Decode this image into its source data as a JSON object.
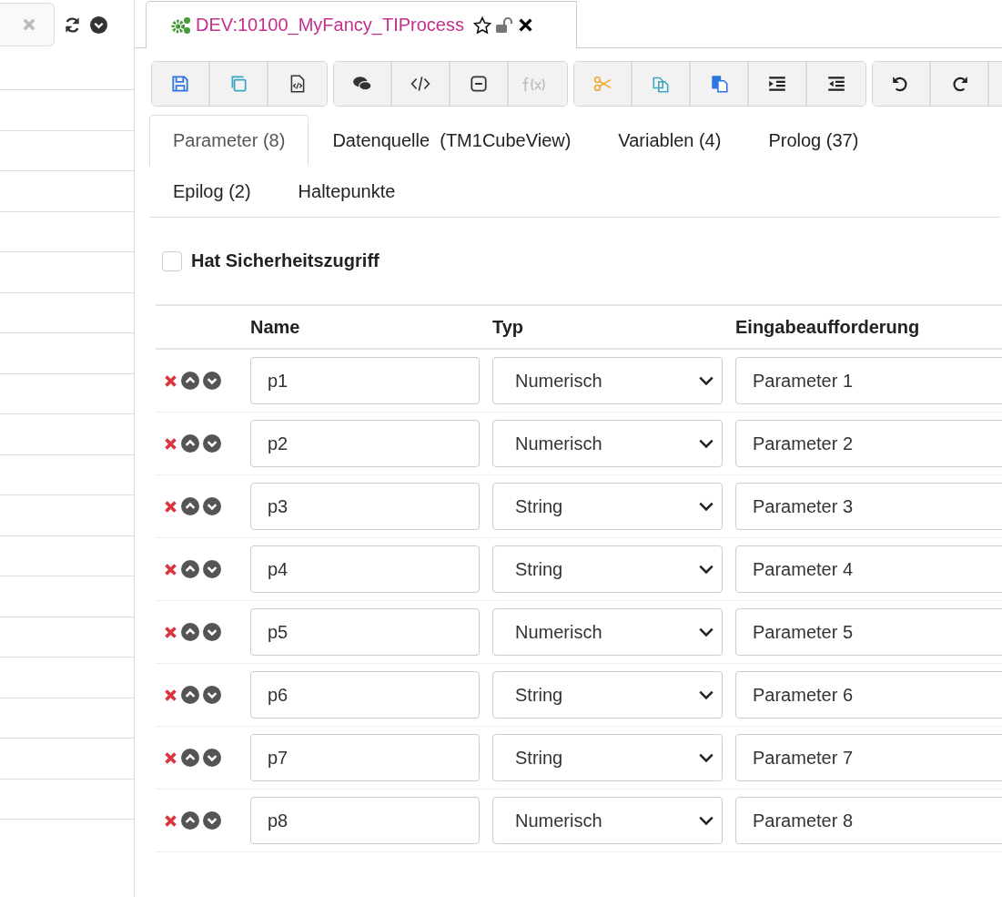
{
  "editor_tab": {
    "title": "DEV:10100_MyFancy_TIProcess"
  },
  "section_tabs": [
    {
      "label": "Parameter (8)",
      "selected": true
    },
    {
      "label": "Datenquelle  (TM1CubeView)",
      "selected": false
    },
    {
      "label": "Variablen (4)",
      "selected": false
    },
    {
      "label": "Prolog (37)",
      "selected": false
    },
    {
      "label": "Epilog (2)",
      "selected": false
    },
    {
      "label": "Haltepunkte",
      "selected": false
    }
  ],
  "security_checkbox": {
    "label": "Hat Sicherheitszugriff",
    "checked": false
  },
  "table": {
    "columns": [
      "Name",
      "Typ",
      "Eingabeaufforderung"
    ],
    "rows": [
      {
        "name": "p1",
        "type": "Numerisch",
        "prompt": "Parameter 1"
      },
      {
        "name": "p2",
        "type": "Numerisch",
        "prompt": "Parameter 2"
      },
      {
        "name": "p3",
        "type": "String",
        "prompt": "Parameter 3"
      },
      {
        "name": "p4",
        "type": "String",
        "prompt": "Parameter 4"
      },
      {
        "name": "p5",
        "type": "Numerisch",
        "prompt": "Parameter 5"
      },
      {
        "name": "p6",
        "type": "String",
        "prompt": "Parameter 6"
      },
      {
        "name": "p7",
        "type": "String",
        "prompt": "Parameter 7"
      },
      {
        "name": "p8",
        "type": "Numerisch",
        "prompt": "Parameter 8"
      }
    ]
  }
}
